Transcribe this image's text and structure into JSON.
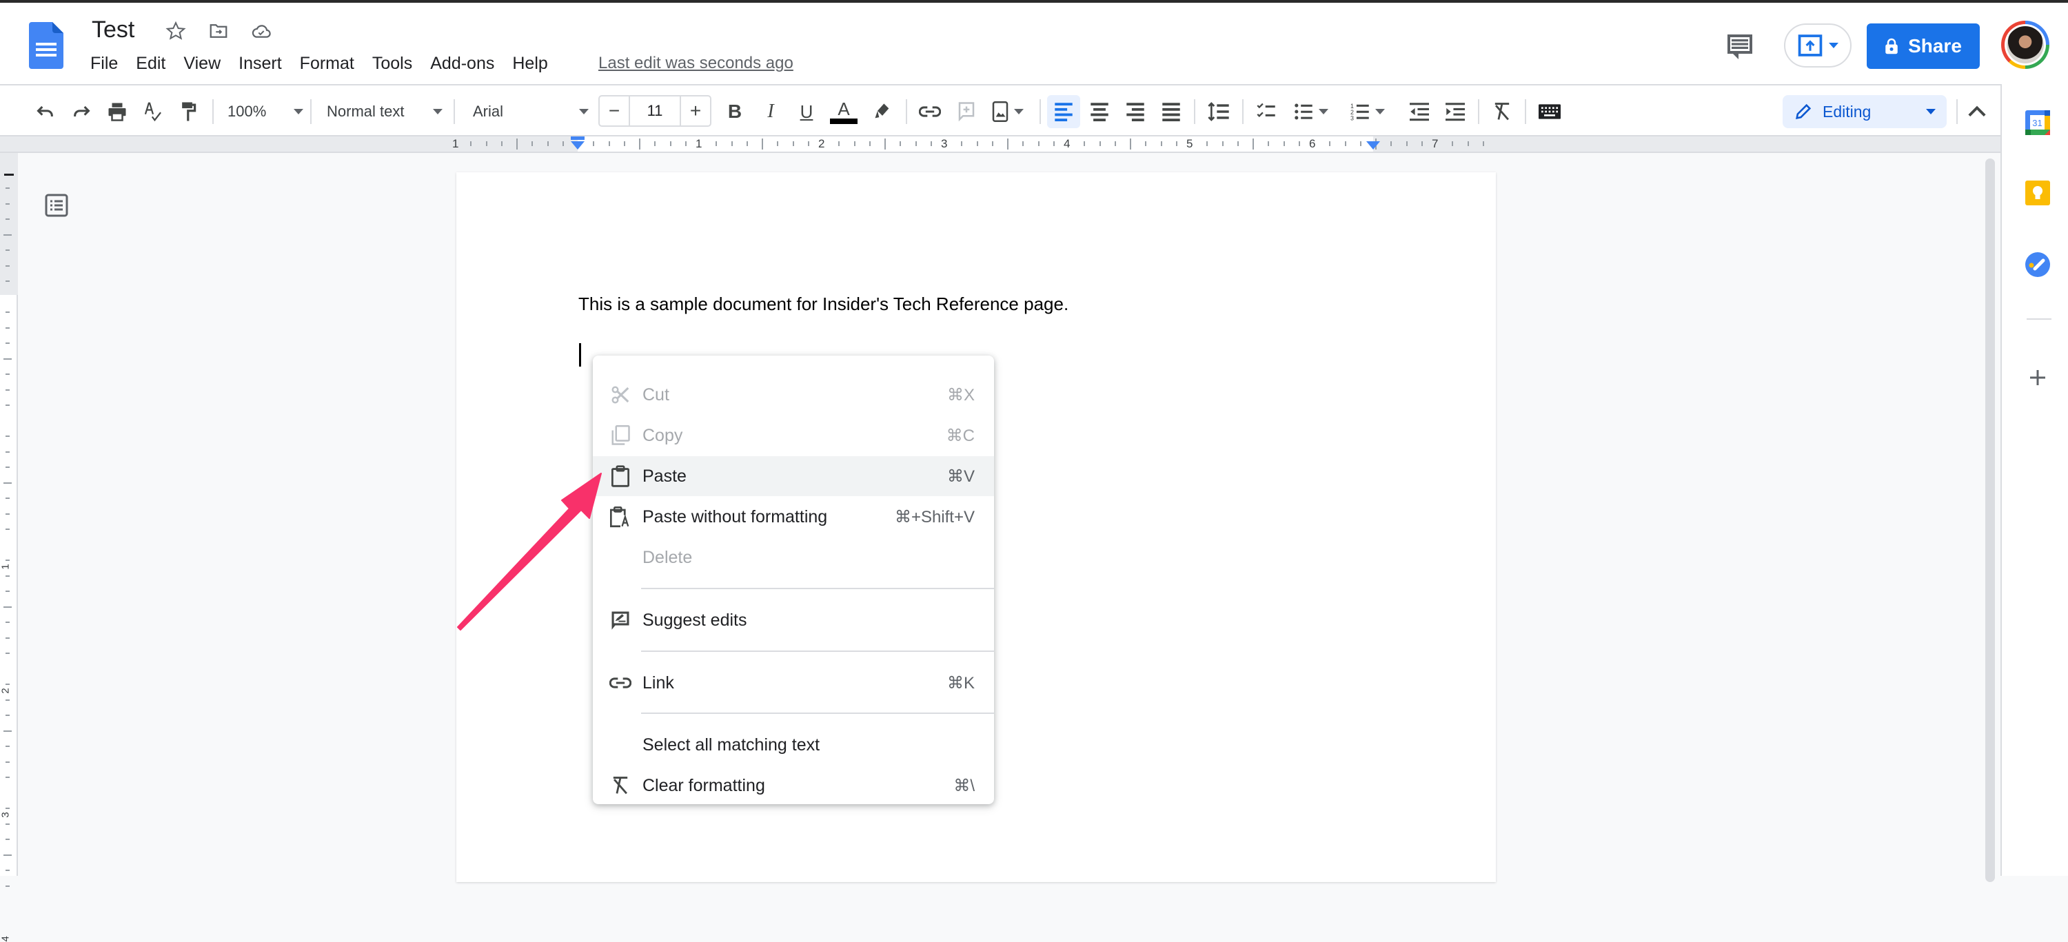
{
  "app": {
    "doc_title": "Test",
    "menus": [
      "File",
      "Edit",
      "View",
      "Insert",
      "Format",
      "Tools",
      "Add-ons",
      "Help"
    ],
    "last_edit": "Last edit was seconds ago",
    "share_label": "Share"
  },
  "toolbar": {
    "zoom": "100%",
    "style": "Normal text",
    "font": "Arial",
    "font_size": "11",
    "minus": "−",
    "plus": "+",
    "mode": "Editing"
  },
  "ruler": {
    "numbers": [
      "1",
      "1",
      "2",
      "3",
      "4",
      "5",
      "6",
      "7"
    ],
    "vertical_numbers": [
      "1",
      "2",
      "3",
      "4"
    ]
  },
  "document": {
    "text": "This is a sample document for Insider's Tech Reference page."
  },
  "context_menu": {
    "items": [
      {
        "label": "Cut",
        "shortcut": "⌘X",
        "icon": "scissors-icon",
        "disabled": true
      },
      {
        "label": "Copy",
        "shortcut": "⌘C",
        "icon": "copy-icon",
        "disabled": true
      },
      {
        "label": "Paste",
        "shortcut": "⌘V",
        "icon": "clipboard-icon",
        "disabled": false,
        "highlighted": true
      },
      {
        "label": "Paste without formatting",
        "shortcut": "⌘+Shift+V",
        "icon": "paste-plain-icon",
        "disabled": false
      },
      {
        "label": "Delete",
        "shortcut": "",
        "icon": "",
        "disabled": true
      },
      {
        "label": "Suggest edits",
        "shortcut": "",
        "icon": "suggest-edit-icon",
        "disabled": false
      },
      {
        "label": "Link",
        "shortcut": "⌘K",
        "icon": "link-icon",
        "disabled": false
      },
      {
        "label": "Select all matching text",
        "shortcut": "",
        "icon": "",
        "disabled": false
      },
      {
        "label": "Clear formatting",
        "shortcut": "⌘\\",
        "icon": "clear-format-icon",
        "disabled": false
      }
    ]
  },
  "side_panel": {
    "calendar_day": "31"
  },
  "colors": {
    "accent": "#1a73e8",
    "annotation_arrow": "#f8316a",
    "editing_bg": "#e8f0fe"
  }
}
